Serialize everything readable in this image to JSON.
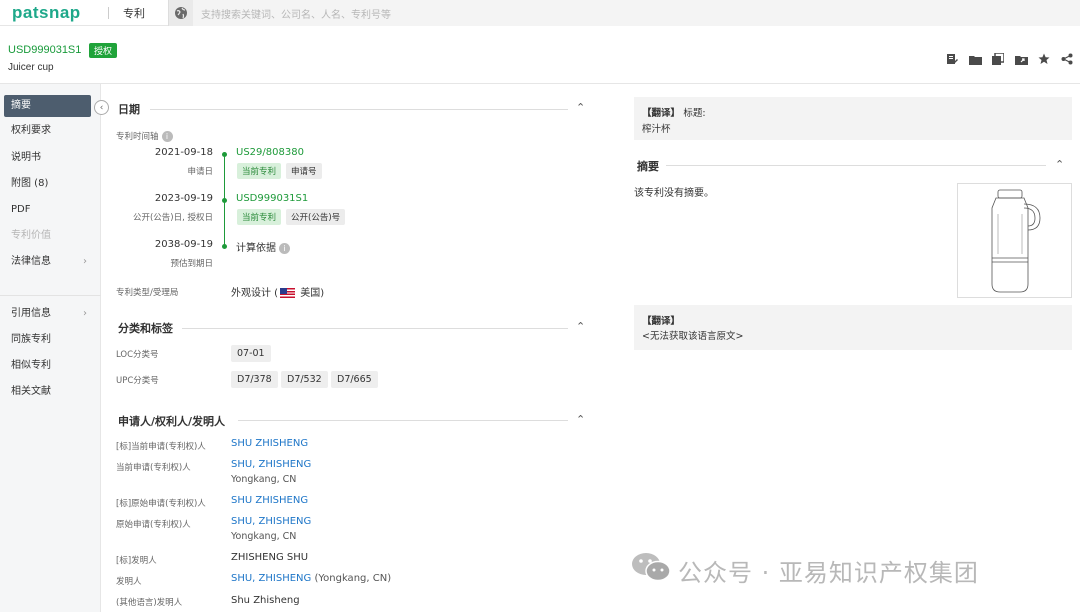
{
  "topbar": {
    "logo": "patsnap",
    "module": "专利",
    "search_placeholder": "支持搜索关键词、公司名、人名、专利号等"
  },
  "patent": {
    "number": "USD999031S1",
    "status_badge": "授权",
    "title": "Juicer cup"
  },
  "nav": {
    "items": [
      {
        "label": "摘要"
      },
      {
        "label": "权利要求"
      },
      {
        "label": "说明书"
      },
      {
        "label": "附图 (8)"
      },
      {
        "label": "PDF"
      },
      {
        "label": "专利价值"
      },
      {
        "label": "法律信息"
      },
      {
        "label": "引用信息"
      },
      {
        "label": "同族专利"
      },
      {
        "label": "相似专利"
      },
      {
        "label": "相关文献"
      }
    ]
  },
  "dates": {
    "section_title": "日期",
    "timeline_label": "专利时间轴",
    "events": [
      {
        "date": "2021-09-18",
        "sub": "申请日",
        "number": "US29/808380",
        "tags": [
          "当前专利",
          "申请号"
        ]
      },
      {
        "date": "2023-09-19",
        "sub": "公开(公告)日, 授权日",
        "number": "USD999031S1",
        "tags": [
          "当前专利",
          "公开(公告)号"
        ]
      },
      {
        "date": "2038-09-19",
        "sub": "预估到期日",
        "number": "计算依据",
        "tags": []
      }
    ],
    "type_label": "专利类型/受理局",
    "type_value_prefix": "外观设计 (",
    "type_value_suffix": " 美国)"
  },
  "classification": {
    "section_title": "分类和标签",
    "loc_label": "LOC分类号",
    "loc_codes": [
      "07-01"
    ],
    "upc_label": "UPC分类号",
    "upc_codes": [
      "D7/378",
      "D7/532",
      "D7/665"
    ]
  },
  "applicants": {
    "section_title": "申请人/权利人/发明人",
    "rows": [
      {
        "label": "[标]当前申请(专利权)人",
        "value": "SHU ZHISHENG",
        "sub": ""
      },
      {
        "label": "当前申请(专利权)人",
        "value": "SHU, ZHISHENG",
        "sub": "Yongkang, CN"
      },
      {
        "label": "[标]原始申请(专利权)人",
        "value": "SHU ZHISHENG",
        "sub": ""
      },
      {
        "label": "原始申请(专利权)人",
        "value": "SHU, ZHISHENG",
        "sub": "Yongkang, CN"
      },
      {
        "label": "[标]发明人",
        "value": "ZHISHENG SHU",
        "sub": ""
      },
      {
        "label": "发明人",
        "value": "SHU, ZHISHENG",
        "value_suffix": " (Yongkang, CN)",
        "sub": ""
      },
      {
        "label": "(其他语言)发明人",
        "value": "Shu Zhisheng",
        "sub": ""
      }
    ]
  },
  "right": {
    "trans1_label": "【翻译】",
    "trans1_field": "标题:",
    "trans1_text": "榨汁杯",
    "abstract_title": "摘要",
    "abstract_text": "该专利没有摘要。",
    "trans2_label": "【翻译】",
    "trans2_text": "<无法获取该语言原文>"
  },
  "watermark": "公众号 · 亚易知识产权集团",
  "colors": {
    "brand": "#1ea88a",
    "grant_green": "#20a33a",
    "link_blue": "#1e76c8",
    "nav_active": "#4d5d6e"
  }
}
